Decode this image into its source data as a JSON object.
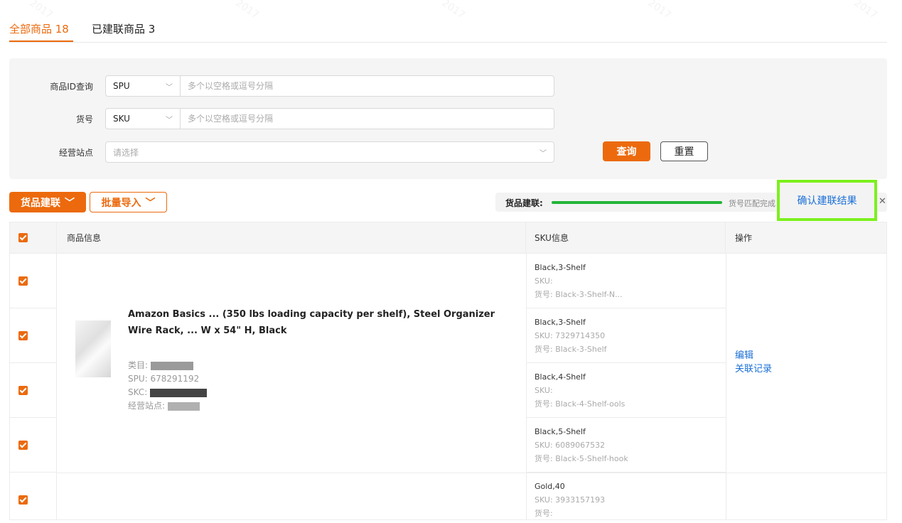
{
  "tabs": [
    {
      "label": "全部商品 18"
    },
    {
      "label": "已建联商品 3"
    }
  ],
  "filters": {
    "product_id": {
      "label": "商品ID查询",
      "type_value": "SPU",
      "placeholder": "多个以空格或逗号分隔"
    },
    "sku_code": {
      "label": "货号",
      "type_value": "SKU",
      "placeholder": "多个以空格或逗号分隔"
    },
    "site": {
      "label": "经营站点",
      "placeholder": "请选择"
    },
    "query_label": "查询",
    "reset_label": "重置"
  },
  "actions": {
    "link_label": "货品建联",
    "import_label": "批量导入",
    "progress_label": "货品建联:",
    "progress_status": "货号匹配完成",
    "progress": 1.0,
    "confirm_label": "确认建联结果",
    "close_glyph": "✕"
  },
  "table": {
    "headers": {
      "product": "商品信息",
      "sku": "SKU信息",
      "ops": "操作"
    },
    "product": {
      "title": "Amazon Basics ... (350 lbs loading capacity per shelf), Steel Organizer Wire Rack, ... W x 54\" H, Black",
      "category": "类目:",
      "spu": "SPU: 678291192",
      "skc": "SKC:",
      "site": "经营站点:"
    },
    "skus": [
      {
        "name": "Black,3-Shelf",
        "sku": "SKU:",
        "code": "货号: Black-3-Shelf-N..."
      },
      {
        "name": "Black,3-Shelf",
        "sku": "SKU: 7329714350",
        "code": "货号: Black-3-Shelf"
      },
      {
        "name": "Black,4-Shelf",
        "sku": "SKU:",
        "code": "货号: Black-4-Shelf-ools"
      },
      {
        "name": "Black,5-Shelf",
        "sku": "SKU: 6089067532",
        "code": "货号: Black-5-Shelf-hook"
      },
      {
        "name": "Gold,40",
        "sku": "SKU: 3933157193",
        "code": "货号:"
      }
    ],
    "ops": {
      "edit": "编辑",
      "records": "关联记录"
    }
  },
  "colors": {
    "accent": "#ec6a0d",
    "link": "#1a6fd8",
    "progress": "#22b537",
    "highlight": "#7cf01d"
  }
}
